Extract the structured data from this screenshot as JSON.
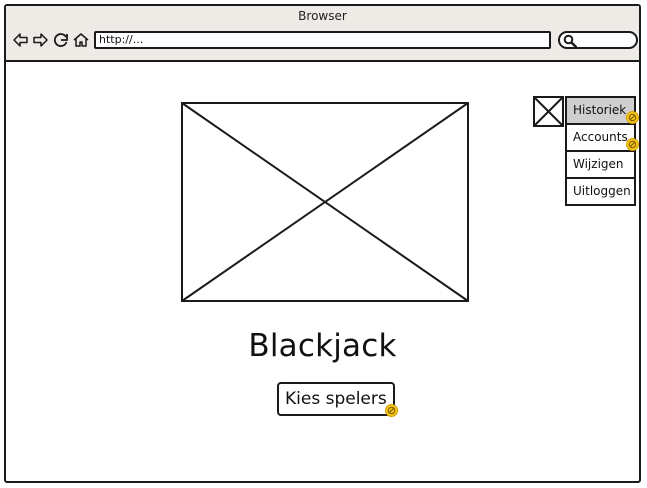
{
  "browser": {
    "title": "Browser",
    "url": "http://...",
    "icons": [
      "back-arrow-icon",
      "forward-arrow-icon",
      "reload-icon",
      "home-icon",
      "search-icon"
    ]
  },
  "main": {
    "heading": "Blackjack",
    "primary_button_label": "Kies spelers"
  },
  "menu": {
    "items": [
      {
        "label": "Historiek",
        "selected": true,
        "has_link": true
      },
      {
        "label": "Accounts",
        "selected": false,
        "has_link": true
      },
      {
        "label": "Wijzigen",
        "selected": false,
        "has_link": false
      },
      {
        "label": "Uitloggen",
        "selected": false,
        "has_link": false
      }
    ]
  },
  "colors": {
    "link_badge": "#f5c518",
    "titlebar": "#eeebe6",
    "selected_menu": "#cfcfcf"
  }
}
